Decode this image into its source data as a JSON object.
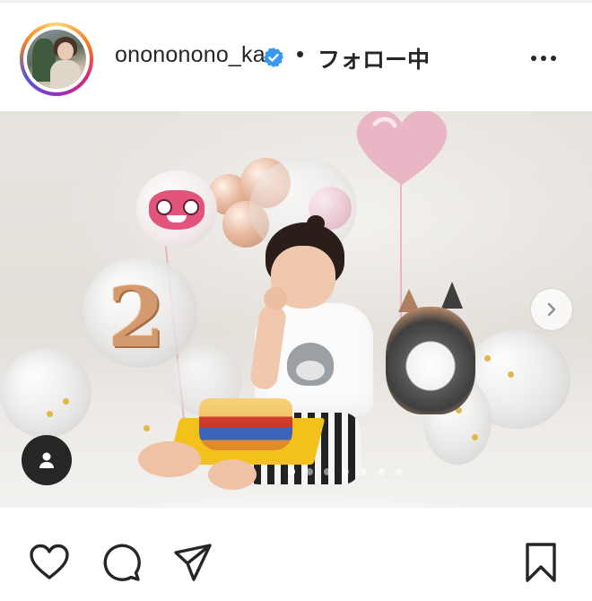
{
  "post_header": {
    "username": "onononono_ka",
    "verified": true,
    "separator": "•",
    "follow_status": "フォロー中"
  },
  "photo": {
    "carousel_total": 7,
    "carousel_active": 1
  },
  "icons": {
    "more": "more-horizontal-icon",
    "verified": "verified-badge-icon",
    "next": "chevron-right-icon",
    "tag": "user-tag-icon",
    "like": "heart-icon",
    "comment": "comment-icon",
    "share": "paper-plane-icon",
    "save": "bookmark-icon"
  },
  "colors": {
    "text": "#262626",
    "verified_blue": "#3897f0",
    "ring_gradient": [
      "#feda75",
      "#fa7e1e",
      "#d62976",
      "#962fbf",
      "#4f5bd5"
    ]
  }
}
